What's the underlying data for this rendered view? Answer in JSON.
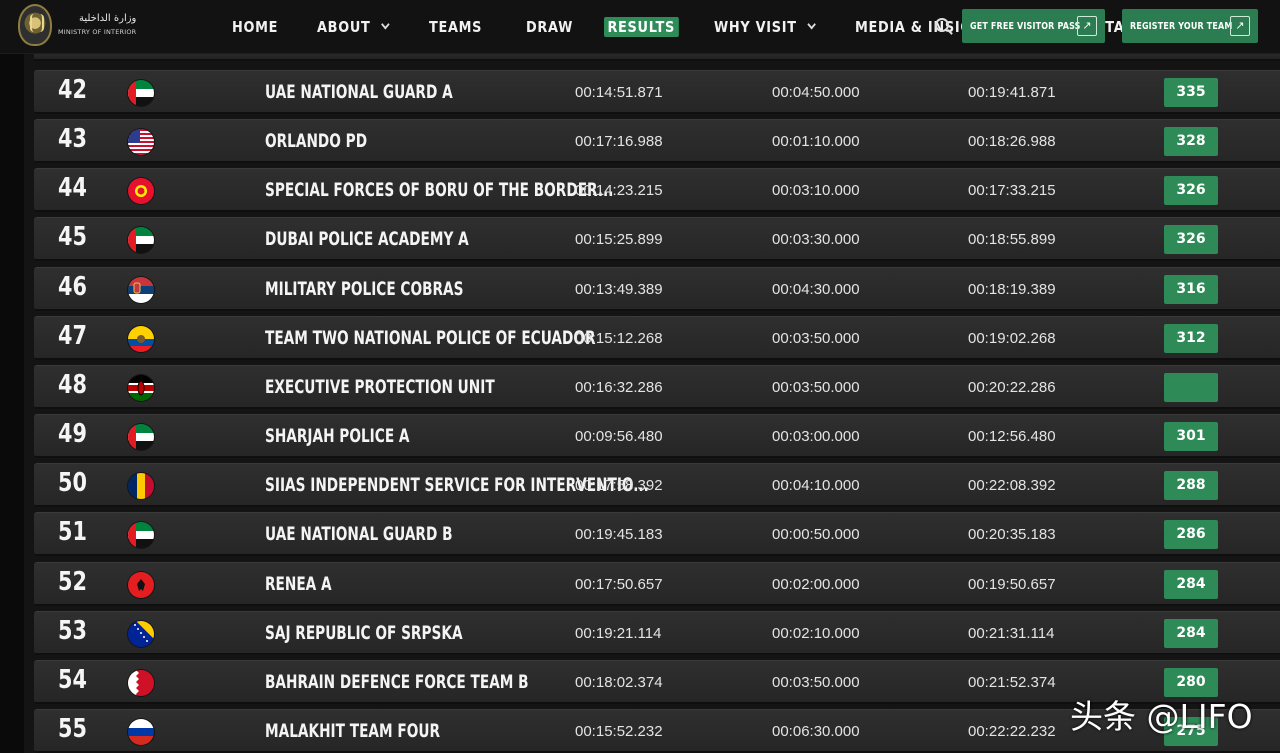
{
  "logo": {
    "arabic_text": "وزارة الداخلية",
    "english_text": "MINISTRY OF INTERIOR"
  },
  "nav": {
    "items": [
      {
        "label": "HOME",
        "name": "nav-home",
        "dropdown": false,
        "active": false
      },
      {
        "label": "ABOUT",
        "name": "nav-about",
        "dropdown": true,
        "active": false
      },
      {
        "label": "TEAMS",
        "name": "nav-teams",
        "dropdown": false,
        "active": false
      },
      {
        "label": "DRAW",
        "name": "nav-draw",
        "dropdown": false,
        "active": false
      },
      {
        "label": "RESULTS",
        "name": "nav-results",
        "dropdown": false,
        "active": true
      },
      {
        "label": "WHY VISIT",
        "name": "nav-why-visit",
        "dropdown": true,
        "active": false
      },
      {
        "label": "MEDIA & INSIGHTS",
        "name": "nav-media-insights",
        "dropdown": true,
        "active": false
      },
      {
        "label": "CONTACT",
        "name": "nav-contact",
        "dropdown": false,
        "active": false
      }
    ],
    "search_icon": "search-icon",
    "visitor_button": "GET FREE VISITOR PASS",
    "register_button": "REGISTER YOUR TEAM",
    "accent_color": "#2e8b57"
  },
  "results": [
    {
      "rank": "42",
      "team": "UAE NATIONAL GUARD A",
      "flag": "uae",
      "time1": "00:14:51.871",
      "time2": "00:04:50.000",
      "time3": "00:19:41.871",
      "points": "335"
    },
    {
      "rank": "43",
      "team": "ORLANDO PD",
      "flag": "usa",
      "time1": "00:17:16.988",
      "time2": "00:01:10.000",
      "time3": "00:18:26.988",
      "points": "328"
    },
    {
      "rank": "44",
      "team": "SPECIAL FORCES OF BORU OF THE BORDER...",
      "flag": "kyrgyzstan",
      "time1": "00:14:23.215",
      "time2": "00:03:10.000",
      "time3": "00:17:33.215",
      "points": "326"
    },
    {
      "rank": "45",
      "team": "DUBAI POLICE ACADEMY A",
      "flag": "uae",
      "time1": "00:15:25.899",
      "time2": "00:03:30.000",
      "time3": "00:18:55.899",
      "points": "326"
    },
    {
      "rank": "46",
      "team": "MILITARY POLICE COBRAS",
      "flag": "serbia",
      "time1": "00:13:49.389",
      "time2": "00:04:30.000",
      "time3": "00:18:19.389",
      "points": "316"
    },
    {
      "rank": "47",
      "team": "TEAM TWO NATIONAL POLICE OF ECUADOR",
      "flag": "ecuador",
      "time1": "00:15:12.268",
      "time2": "00:03:50.000",
      "time3": "00:19:02.268",
      "points": "312"
    },
    {
      "rank": "48",
      "team": "EXECUTIVE PROTECTION UNIT",
      "flag": "kenya",
      "time1": "00:16:32.286",
      "time2": "00:03:50.000",
      "time3": "00:20:22.286",
      "points": ""
    },
    {
      "rank": "49",
      "team": "SHARJAH POLICE A",
      "flag": "uae",
      "time1": "00:09:56.480",
      "time2": "00:03:00.000",
      "time3": "00:12:56.480",
      "points": "301"
    },
    {
      "rank": "50",
      "team": "SIIAS INDEPENDENT SERVICE FOR INTERVENTIO...",
      "flag": "chad",
      "time1": "00:17:58.392",
      "time2": "00:04:10.000",
      "time3": "00:22:08.392",
      "points": "288"
    },
    {
      "rank": "51",
      "team": "UAE NATIONAL GUARD B",
      "flag": "uae",
      "time1": "00:19:45.183",
      "time2": "00:00:50.000",
      "time3": "00:20:35.183",
      "points": "286"
    },
    {
      "rank": "52",
      "team": "RENEA A",
      "flag": "albania",
      "time1": "00:17:50.657",
      "time2": "00:02:00.000",
      "time3": "00:19:50.657",
      "points": "284"
    },
    {
      "rank": "53",
      "team": "SAJ REPUBLIC OF SRPSKA",
      "flag": "bosnia",
      "time1": "00:19:21.114",
      "time2": "00:02:10.000",
      "time3": "00:21:31.114",
      "points": "284"
    },
    {
      "rank": "54",
      "team": "BAHRAIN DEFENCE FORCE TEAM B",
      "flag": "bahrain",
      "time1": "00:18:02.374",
      "time2": "00:03:50.000",
      "time3": "00:21:52.374",
      "points": "280"
    },
    {
      "rank": "55",
      "team": "MALAKHIT TEAM FOUR",
      "flag": "russia",
      "time1": "00:15:52.232",
      "time2": "00:06:30.000",
      "time3": "00:22:22.232",
      "points": "275"
    }
  ],
  "watermark": "头条 @LIFO"
}
